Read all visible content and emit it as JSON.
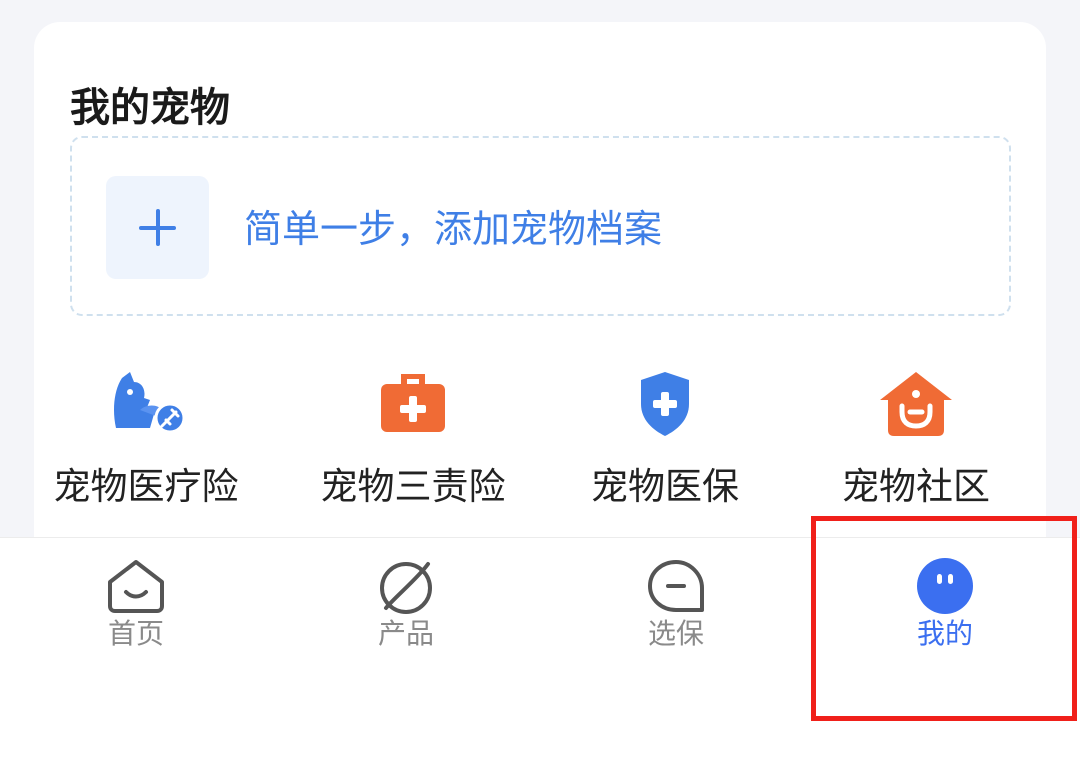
{
  "pets_card": {
    "title": "我的宠物",
    "add_profile_text": "简单一步，添加宠物档案",
    "add_icon": "plus-icon"
  },
  "features": [
    {
      "label": "宠物医疗险",
      "icon": "pet-vaccine-icon",
      "color": "#3f7fe6"
    },
    {
      "label": "宠物三责险",
      "icon": "first-aid-kit-icon",
      "color": "#f06b35"
    },
    {
      "label": "宠物医保",
      "icon": "shield-plus-icon",
      "color": "#3f7fe6"
    },
    {
      "label": "宠物社区",
      "icon": "pet-house-icon",
      "color": "#f06b35"
    }
  ],
  "tabbar": {
    "items": [
      {
        "label": "首页",
        "icon": "home-icon",
        "active": false
      },
      {
        "label": "产品",
        "icon": "planet-icon",
        "active": false
      },
      {
        "label": "选保",
        "icon": "select-insurance-icon",
        "active": false
      },
      {
        "label": "我的",
        "icon": "profile-face-icon",
        "active": true
      }
    ],
    "active_color": "#3b6ff0",
    "inactive_color": "#8a8a8a"
  },
  "highlight_color": "#f0201a"
}
